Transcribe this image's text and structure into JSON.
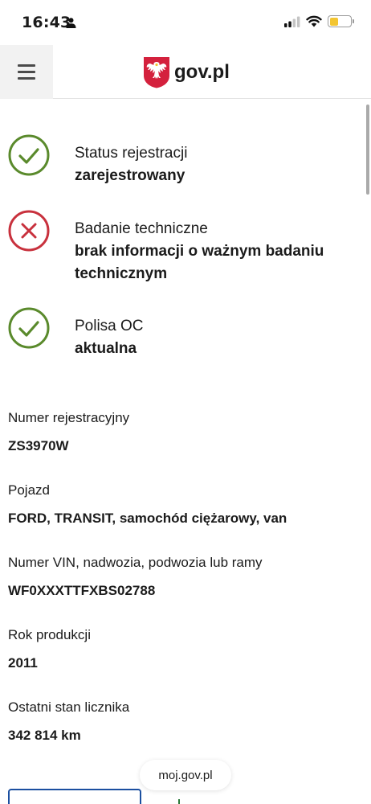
{
  "status_bar": {
    "time": "16:43",
    "battery_color": "#f3c531",
    "icons": [
      "person-icon",
      "signal-icon",
      "wifi-icon",
      "battery-icon"
    ]
  },
  "header": {
    "menu_icon": "hamburger-menu-icon",
    "logo_text": "gov.pl",
    "logo_icon": "polish-eagle-emblem"
  },
  "statuses": [
    {
      "label": "Status rejestracji",
      "value": [
        "zarejestrowany"
      ],
      "icon": "check-circle-icon",
      "color": "#5a8a2c"
    },
    {
      "label": "Badanie techniczne",
      "value": [
        "brak informacji o ważnym badaniu",
        "technicznym"
      ],
      "icon": "x-circle-icon",
      "color": "#c8313d"
    },
    {
      "label": "Polisa OC",
      "value": [
        "aktualna"
      ],
      "icon": "check-circle-icon",
      "color": "#5a8a2c"
    }
  ],
  "details": [
    {
      "label": "Numer rejestracyjny",
      "value": "ZS3970W"
    },
    {
      "label": "Pojazd",
      "value": "FORD, TRANSIT, samochód ciężarowy, van"
    },
    {
      "label": "Numer VIN, nadwozia, podwozia lub ramy",
      "value": "WF0XXXTTFXBS02788"
    },
    {
      "label": "Rok produkcji",
      "value": "2011"
    },
    {
      "label": "Ostatni stan licznika",
      "value": "342 814 km"
    }
  ],
  "browser": {
    "url": "moj.gov.pl"
  }
}
